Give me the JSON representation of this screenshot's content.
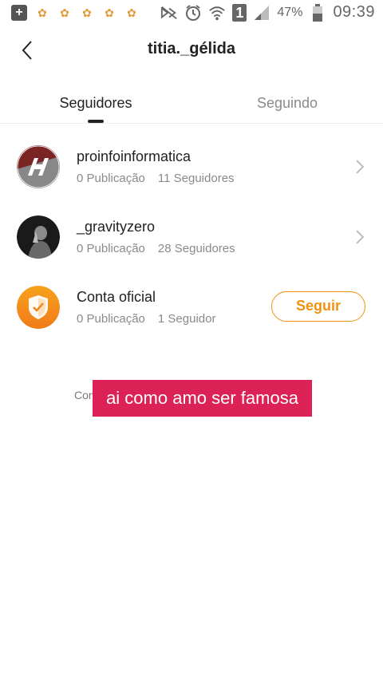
{
  "status_bar": {
    "battery_percent": "47%",
    "time": "09:39",
    "sim_slot": "1"
  },
  "header": {
    "title": "titia._gélida"
  },
  "tabs": [
    {
      "label": "Seguidores",
      "active": true
    },
    {
      "label": "Seguindo",
      "active": false
    }
  ],
  "users": [
    {
      "name": "proinfoinformatica",
      "posts": "0 Publicação",
      "followers": "11 Seguidores",
      "action": "chevron"
    },
    {
      "name": "_gravityzero",
      "posts": "0 Publicação",
      "followers": "28 Seguidores",
      "action": "chevron"
    },
    {
      "name": "Conta oficial",
      "posts": "0 Publicação",
      "followers": "1 Seguidor",
      "action": "follow",
      "follow_label": "Seguir"
    }
  ],
  "toast": {
    "background_text": "Con",
    "message": "ai como amo ser famosa"
  },
  "colors": {
    "accent": "#f0920f",
    "toast": "#db2155"
  }
}
